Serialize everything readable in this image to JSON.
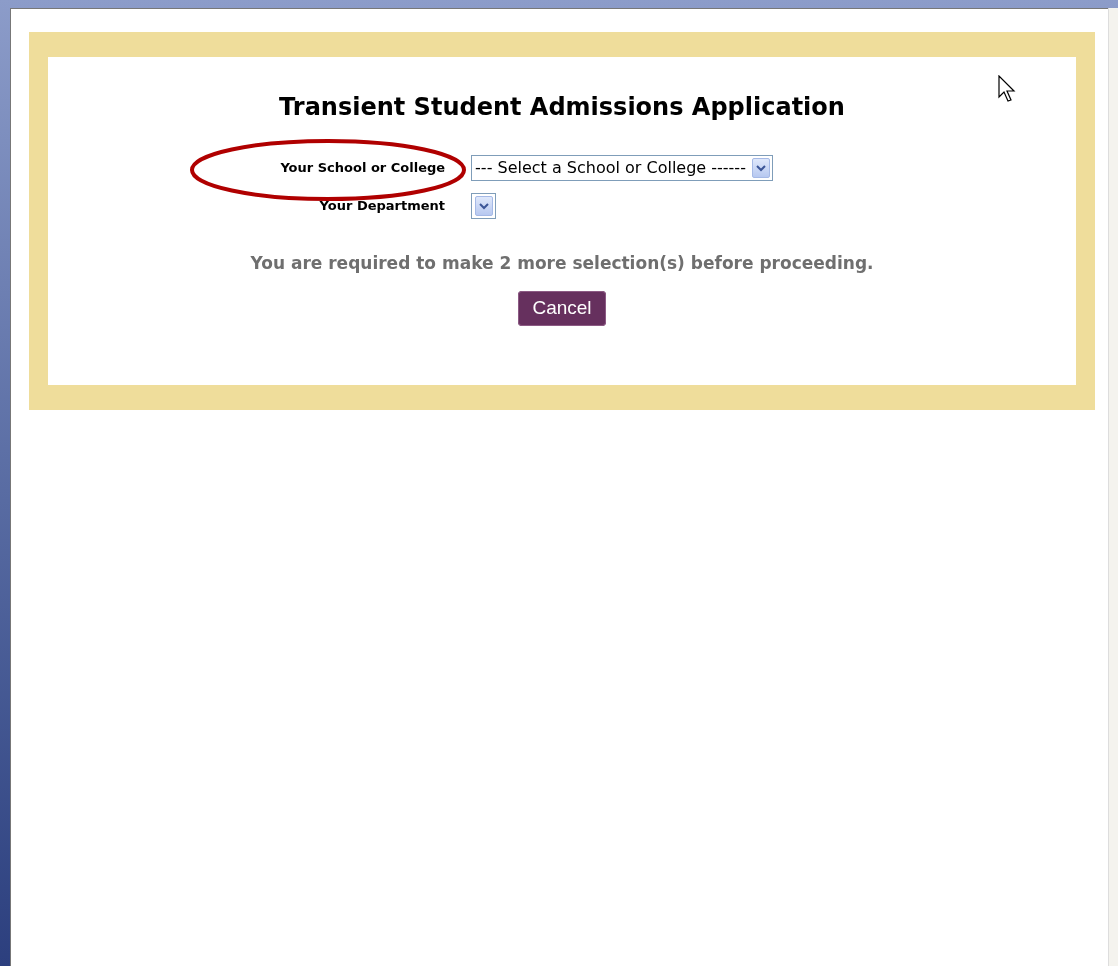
{
  "form": {
    "title": "Transient Student Admissions Application",
    "fields": [
      {
        "label": "Your School or College",
        "value": "--- Select a School or College ------",
        "highlighted": true
      },
      {
        "label": "Your Department",
        "highlighted": false
      }
    ],
    "message": "You are required to make 2 more selection(s) before proceeding.",
    "cancel_button": "Cancel"
  }
}
